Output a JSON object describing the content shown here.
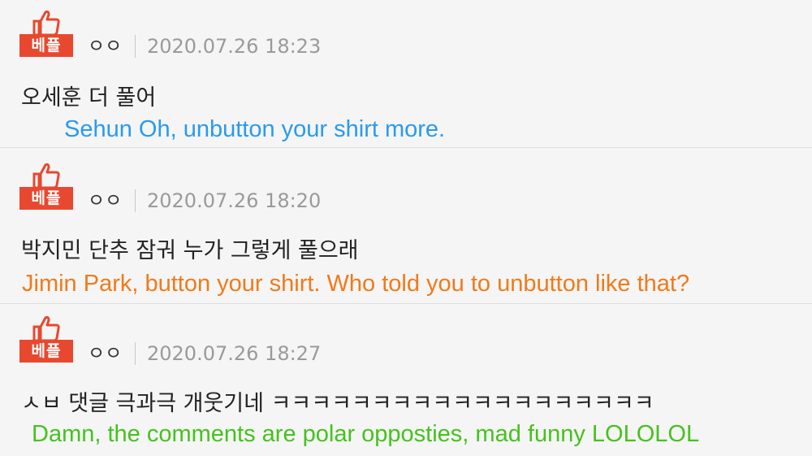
{
  "colors": {
    "background": "#f5f5f5",
    "badge": "#e8482f",
    "translation_blue": "#2a9af0",
    "translation_orange": "#f07a1a",
    "translation_green": "#45c21e"
  },
  "comments": [
    {
      "badge_label": "베플",
      "badge_icon": "thumbs-up-icon",
      "nickname": "ㅇㅇ",
      "timestamp": "2020.07.26 18:23",
      "text": "오세훈 더 풀어",
      "translation": "Sehun Oh, unbutton your shirt more."
    },
    {
      "badge_label": "베플",
      "badge_icon": "thumbs-up-icon",
      "nickname": "ㅇㅇ",
      "timestamp": "2020.07.26 18:20",
      "text": "박지민 단추 잠궈 누가 그렇게 풀으래",
      "translation": "Jimin Park, button your shirt. Who told you to unbutton like that?"
    },
    {
      "badge_label": "베플",
      "badge_icon": "thumbs-up-icon",
      "nickname": "ㅇㅇ",
      "timestamp": "2020.07.26 18:27",
      "text": "ㅅㅂ 댓글 극과극 개웃기네 ㅋㅋㅋㅋㅋㅋㅋㅋㅋㅋㅋㅋㅋㅋㅋㅋㅋㅋㅋ",
      "translation": "Damn, the comments are polar opposties, mad funny LOLOLOL"
    }
  ]
}
